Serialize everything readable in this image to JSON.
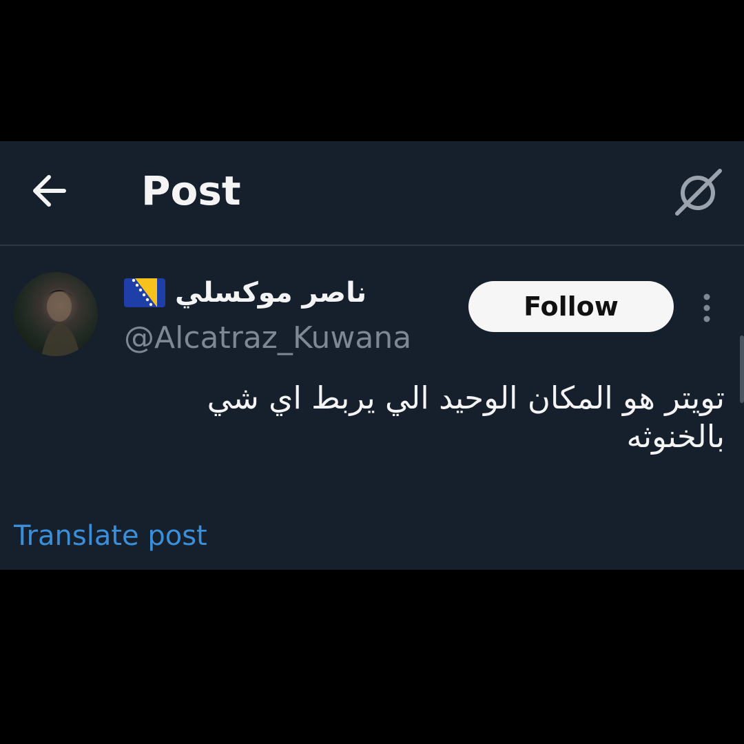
{
  "header": {
    "title": "Post",
    "back_icon": "arrow-left-icon",
    "grok_icon": "grok-icon"
  },
  "author": {
    "display_name": "ناصر موكسلي",
    "flag_icon": "bosnia-flag-icon",
    "handle": "@Alcatraz_Kuwana"
  },
  "actions": {
    "follow_label": "Follow",
    "more_icon": "more-vertical-icon"
  },
  "post": {
    "text": "تويتر هو المكان الوحيد الي يربط اي شي بالخنوثه",
    "translate_label": "Translate post"
  },
  "colors": {
    "background": "#161f2c",
    "text": "#f4f4f4",
    "muted": "#7d8894",
    "link": "#3b8fd9",
    "follow_bg": "#f6f6f6"
  }
}
